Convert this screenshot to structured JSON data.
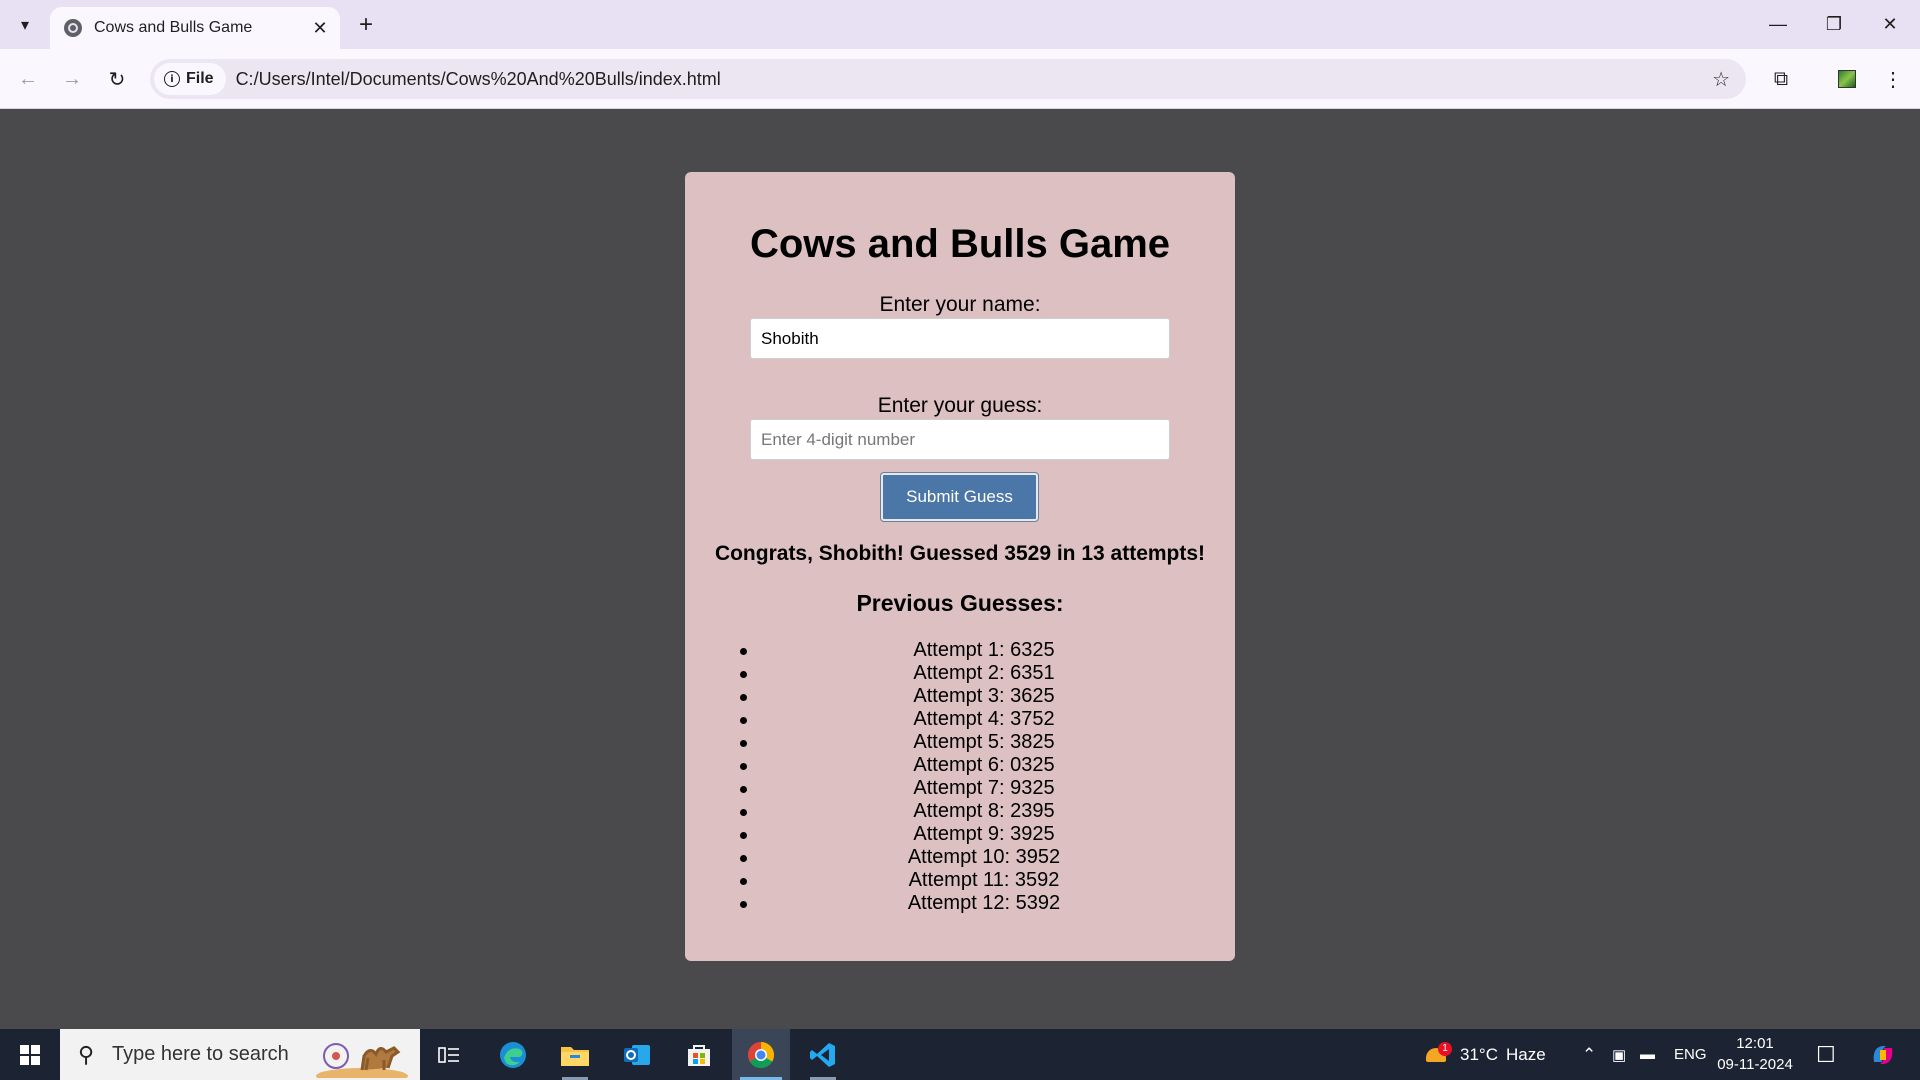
{
  "browser": {
    "tab_title": "Cows and Bulls Game",
    "site_chip": "File",
    "url": "C:/Users/Intel/Documents/Cows%20And%20Bulls/index.html"
  },
  "game": {
    "title": "Cows and Bulls Game",
    "name_label": "Enter your name:",
    "name_value": "Shobith",
    "guess_label": "Enter your guess:",
    "guess_placeholder": "Enter 4-digit number",
    "guess_value": "",
    "submit_label": "Submit Guess",
    "result_message": "Congrats, Shobith! Guessed 3529 in 13 attempts!",
    "previous_heading": "Previous Guesses:",
    "previous_guesses": [
      "Attempt 1: 6325",
      "Attempt 2: 6351",
      "Attempt 3: 3625",
      "Attempt 4: 3752",
      "Attempt 5: 3825",
      "Attempt 6: 0325",
      "Attempt 7: 9325",
      "Attempt 8: 2395",
      "Attempt 9: 3925",
      "Attempt 10: 3952",
      "Attempt 11: 3592",
      "Attempt 12: 5392"
    ]
  },
  "taskbar": {
    "search_placeholder": "Type here to search",
    "weather_temp": "31°C",
    "weather_desc": "Haze",
    "weather_badge": "1",
    "language": "ENG",
    "time": "12:01",
    "date": "09-11-2024"
  },
  "colors": {
    "page_background": "#4a4a4d",
    "card_background": "#dcc0c2",
    "button_background": "#4a76a8",
    "taskbar_background": "#1c2433"
  }
}
